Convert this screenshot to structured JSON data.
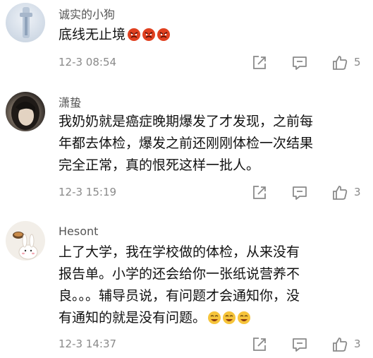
{
  "comments": [
    {
      "username": "诚实的小狗",
      "text": "底线无止境",
      "emojis": [
        "angry-face-icon",
        "angry-face-icon",
        "angry-face-icon"
      ],
      "time": "12-3 08:54",
      "likes": "5"
    },
    {
      "username": "潇蛰",
      "lines": [
        "我奶奶就是癌症晚期爆发了才发现，之前每",
        "年都去体检，爆发之前还刚刚体检一次结果",
        "完全正常，真的恨死这样一批人。"
      ],
      "time": "12-3 15:19",
      "likes": "3"
    },
    {
      "username": "Hesont",
      "lines": [
        "上了大学，我在学校做的体检，从来没有",
        "报告单。小学的还会给你一张纸说营养不",
        "良。。。辅导员说，有问题才会通知你，没",
        "有通知的就是没有问题。"
      ],
      "emojis": [
        "laughing-face-icon",
        "laughing-face-icon",
        "laughing-face-icon"
      ],
      "time": "12-3 14:37",
      "likes": "3"
    }
  ],
  "icons": {
    "share": "share-icon",
    "reply": "comment-icon",
    "like": "thumbs-up-icon"
  },
  "colors": {
    "username": "#555555",
    "meta": "#8a8a8a",
    "text": "#111111",
    "angry_emoji": "#e0401f",
    "laugh_emoji": "#f6c43a"
  }
}
